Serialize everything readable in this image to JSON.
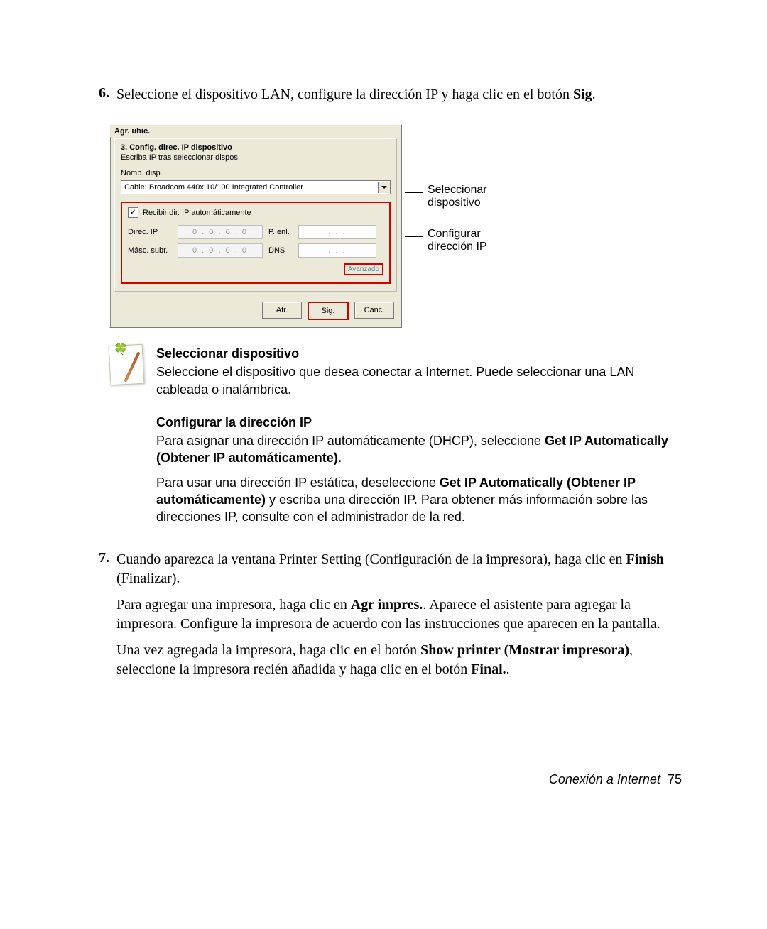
{
  "step6": {
    "num": "6.",
    "text_a": "Seleccione el dispositivo LAN, configure la dirección IP y haga clic en el botón ",
    "text_b": "Sig",
    "text_c": "."
  },
  "dialog": {
    "title": "Agr. ubic.",
    "heading": "3. Config. direc. IP dispositivo",
    "sub": "Escriba IP tras seleccionar dispos.",
    "name_label": "Nomb. disp.",
    "combo_value": "Cable: Broadcom 440x 10/100 Integrated Controller",
    "checkbox_label": "Recibir dir. IP automáticamente",
    "row1_label": "Direc. IP",
    "row1_ip": "0 . 0 . 0 . 0",
    "row1_right_label": "P. enl.",
    "row1_right_ip": " . . . ",
    "row2_label": "Másc. subr.",
    "row2_ip": "0 . 0 . 0 . 0",
    "row2_right_label": "DNS",
    "row2_right_ip": " . . . ",
    "advanced": "Avanzado",
    "btn_back": "Atr.",
    "btn_next": "Sig.",
    "btn_cancel": "Canc."
  },
  "callouts": {
    "c1a": "Seleccionar",
    "c1b": "dispositivo",
    "c2a": "Configurar",
    "c2b": "dirección IP"
  },
  "note": {
    "t1": "Seleccionar dispositivo",
    "p1": "Seleccione el dispositivo que desea conectar a Internet. Puede seleccionar una LAN cableada o inalámbrica.",
    "t2": "Configurar la dirección IP",
    "p2a": "Para asignar una dirección IP automáticamente (DHCP), seleccione ",
    "p2b": "Get IP Automatically (Obtener IP automáticamente).",
    "p3a": "Para usar una dirección IP estática, deseleccione ",
    "p3b": "Get IP Automatically (Obtener IP automáticamente)",
    "p3c": " y escriba una dirección IP. Para obtener más información sobre las direcciones IP, consulte con el administrador de la red."
  },
  "step7": {
    "num": "7.",
    "p1a": "Cuando aparezca la ventana Printer Setting (Configuración de la impresora), haga clic en ",
    "p1b": "Finish",
    "p1c": " (Finalizar).",
    "p2a": "Para agregar una impresora, haga clic en ",
    "p2b": "Agr impres.",
    "p2c": ". Aparece el asistente para agregar la impresora. Configure la impresora de acuerdo con las instrucciones que aparecen en la pantalla.",
    "p3a": "Una vez agregada la impresora, haga clic en el botón ",
    "p3b": "Show printer (Mostrar impresora)",
    "p3c": ", seleccione la impresora recién añadida y haga clic en el botón ",
    "p3d": "Final.",
    "p3e": "."
  },
  "footer": {
    "label": "Conexión a Internet",
    "page": "75"
  }
}
